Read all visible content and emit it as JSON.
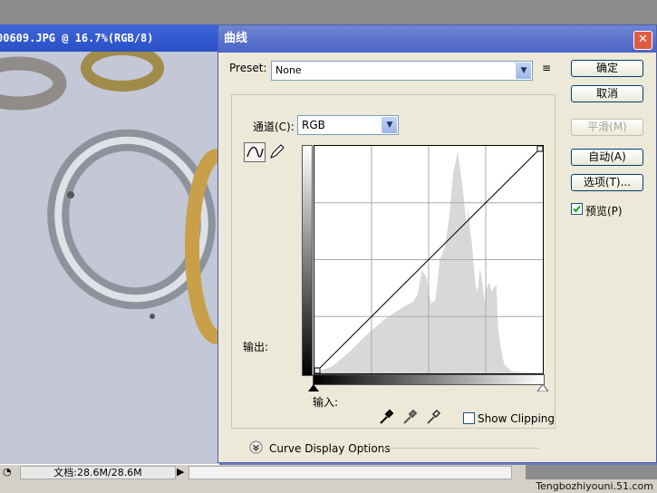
{
  "document": {
    "title": "00609.JPG @ 16.7%(RGB/8)",
    "status": "文档:28.6M/28.6M"
  },
  "watermark": "Tengbozhiyouni.51.com",
  "dialog": {
    "title": "曲线",
    "preset": {
      "label": "Preset:",
      "value": "None"
    },
    "channel": {
      "label": "通道(C):",
      "value": "RGB"
    },
    "output_label": "输出:",
    "input_label": "输入:",
    "show_clipping": {
      "label": "Show Clipping",
      "checked": false
    },
    "display_options": "Curve Display Options",
    "buttons": {
      "ok": "确定",
      "cancel": "取消",
      "smooth": "平滑(M)",
      "auto": "自动(A)",
      "options": "选项(T)..."
    },
    "preview": {
      "label": "预览(P)",
      "checked": true
    }
  },
  "chart_data": {
    "type": "area",
    "title": "",
    "xlabel": "输入:",
    "ylabel": "输出:",
    "xlim": [
      0,
      255
    ],
    "ylim": [
      0,
      255
    ],
    "grid": true,
    "histogram": {
      "x": [
        0,
        20,
        40,
        60,
        80,
        100,
        110,
        115,
        120,
        125,
        130,
        135,
        140,
        145,
        150,
        155,
        160,
        165,
        170,
        172,
        174,
        176,
        178,
        180,
        182,
        185,
        188,
        190,
        192,
        195,
        198,
        200,
        203,
        205,
        208,
        212,
        220,
        255
      ],
      "y": [
        0,
        8,
        25,
        45,
        62,
        75,
        80,
        88,
        115,
        108,
        78,
        82,
        128,
        140,
        170,
        225,
        248,
        212,
        165,
        185,
        158,
        145,
        118,
        98,
        92,
        118,
        98,
        80,
        95,
        102,
        92,
        95,
        100,
        52,
        28,
        10,
        2,
        0
      ]
    },
    "curve": {
      "x": [
        0,
        255
      ],
      "y": [
        0,
        255
      ]
    }
  }
}
